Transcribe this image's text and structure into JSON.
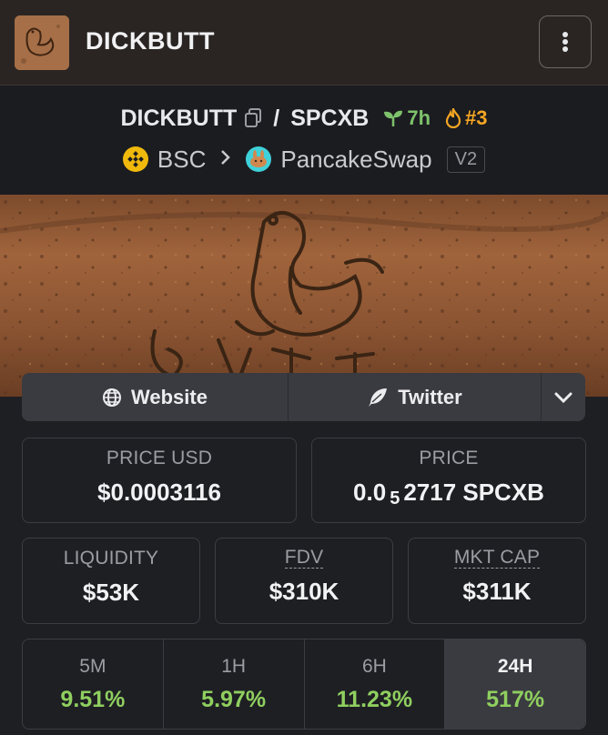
{
  "header": {
    "title": "DICKBUTT",
    "logo_icon": "dickbutt-logo",
    "menu_icon": "vertical-ellipsis-icon"
  },
  "pair": {
    "base": "DICKBUTT",
    "quote": "SPCXB",
    "separator": "/",
    "age": "7h",
    "rank": "#3",
    "chain": "BSC",
    "dex": "PancakeSwap",
    "version": "V2"
  },
  "links": {
    "website": "Website",
    "twitter": "Twitter"
  },
  "stats": {
    "price_usd_label": "PRICE USD",
    "price_usd": "$0.0003116",
    "price_label": "PRICE",
    "price_prefix": "0.0",
    "price_sub": "5",
    "price_rest": "2717 SPCXB",
    "liquidity_label": "LIQUIDITY",
    "liquidity": "$53K",
    "fdv_label": "FDV",
    "fdv": "$310K",
    "mktcap_label": "MKT CAP",
    "mktcap": "$311K"
  },
  "timeframes": [
    {
      "label": "5M",
      "value": "9.51%"
    },
    {
      "label": "1H",
      "value": "5.97%"
    },
    {
      "label": "6H",
      "value": "11.23%"
    },
    {
      "label": "24H",
      "value": "517%"
    }
  ],
  "colors": {
    "positive": "#8fcf5f",
    "age_green": "#7ec26b",
    "rank_orange": "#f5a623",
    "bnb_yellow": "#f0b90b"
  }
}
